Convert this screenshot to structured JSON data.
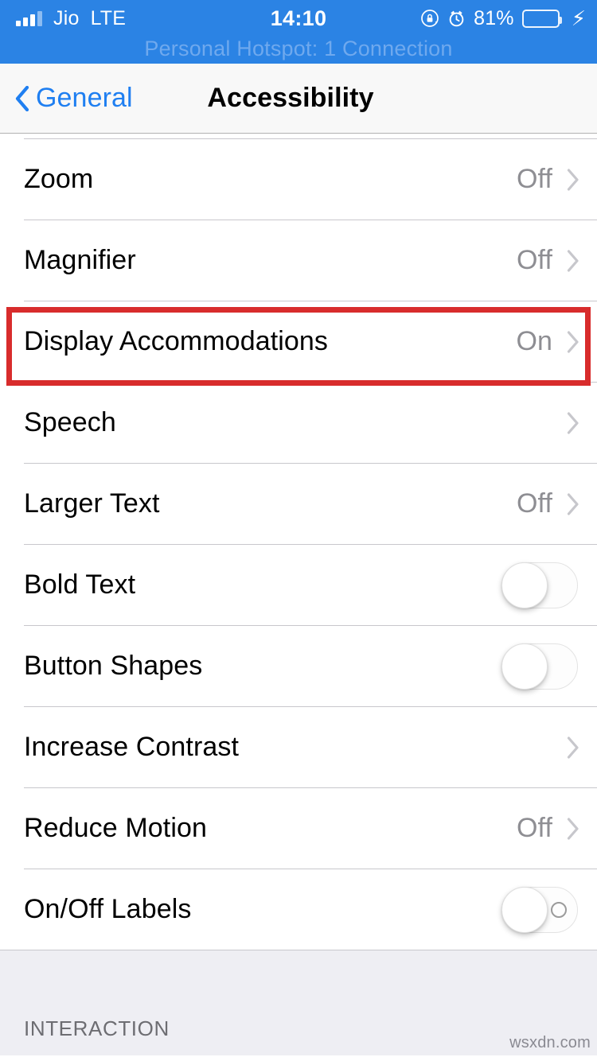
{
  "status_bar": {
    "carrier": "Jio",
    "network": "LTE",
    "time": "14:10",
    "battery_percent": "81%",
    "signal_bars_filled": 3,
    "signal_bars_total": 4,
    "rotation_lock_icon": "rotation-lock-icon",
    "alarm_icon": "alarm-clock-icon",
    "charging_icon": "lightning-bolt-icon",
    "background_color": "#2b83e4"
  },
  "hotspot_banner": {
    "text": "Personal Hotspot: 1 Connection"
  },
  "nav_bar": {
    "back_label": "General",
    "title": "Accessibility",
    "back_icon": "chevron-left-icon",
    "tint_color": "#1f7ff1"
  },
  "rows": [
    {
      "label": "Zoom",
      "value": "Off",
      "type": "disclosure"
    },
    {
      "label": "Magnifier",
      "value": "Off",
      "type": "disclosure"
    },
    {
      "label": "Display Accommodations",
      "value": "On",
      "type": "disclosure",
      "highlighted": true
    },
    {
      "label": "Speech",
      "value": "",
      "type": "disclosure"
    },
    {
      "label": "Larger Text",
      "value": "Off",
      "type": "disclosure"
    },
    {
      "label": "Bold Text",
      "value": "",
      "type": "toggle",
      "toggle_on": false
    },
    {
      "label": "Button Shapes",
      "value": "",
      "type": "toggle",
      "toggle_on": false
    },
    {
      "label": "Increase Contrast",
      "value": "",
      "type": "disclosure"
    },
    {
      "label": "Reduce Motion",
      "value": "Off",
      "type": "disclosure"
    },
    {
      "label": "On/Off Labels",
      "value": "",
      "type": "toggle",
      "toggle_on": false,
      "show_off_label": true
    }
  ],
  "next_section": {
    "header": "INTERACTION"
  },
  "watermark": {
    "text": "wsxdn.com"
  },
  "annotation": {
    "highlight_color": "#d82c2c",
    "target_row_label": "Display Accommodations"
  }
}
